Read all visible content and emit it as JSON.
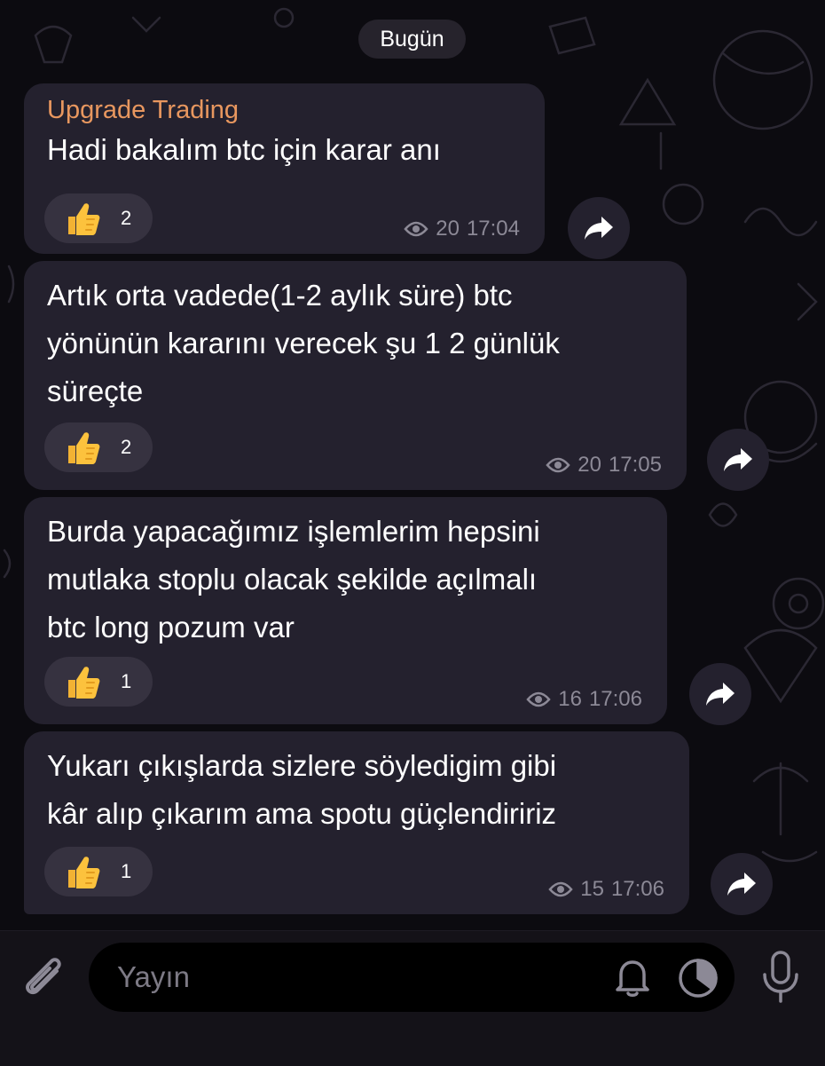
{
  "chat": {
    "date_label": "Bugün",
    "messages": [
      {
        "sender": "Upgrade Trading",
        "text": [
          "Hadi bakalım btc için karar anı"
        ],
        "reaction": {
          "emoji": "thumbs-up",
          "count": "2"
        },
        "views": "20",
        "time": "17:04"
      },
      {
        "text": [
          "Artık orta vadede(1-2 aylık süre) btc",
          "yönünün kararını verecek şu 1 2 günlük",
          "süreçte"
        ],
        "reaction": {
          "emoji": "thumbs-up",
          "count": "2"
        },
        "views": "20",
        "time": "17:05"
      },
      {
        "text": [
          "Burda yapacağımız işlemlerim hepsini",
          "mutlaka stoplu olacak şekilde açılmalı",
          "btc long pozum var"
        ],
        "reaction": {
          "emoji": "thumbs-up",
          "count": "1"
        },
        "views": "16",
        "time": "17:06"
      },
      {
        "text": [
          "Yukarı çıkışlarda sizlere söyledigim gibi",
          "kâr alıp çıkarım ama spotu güçlendiririz"
        ],
        "reaction": {
          "emoji": "thumbs-up",
          "count": "1"
        },
        "views": "15",
        "time": "17:06"
      }
    ]
  },
  "composer": {
    "placeholder": "Yayın",
    "icons": [
      "paperclip-icon",
      "bell-icon",
      "timer-icon",
      "microphone-icon"
    ]
  },
  "colors": {
    "background": "#0c0b10",
    "bubble": "#24212e",
    "sender_name": "#e8975f",
    "meta_text": "#8c8996",
    "reaction_pill": "#363240"
  }
}
